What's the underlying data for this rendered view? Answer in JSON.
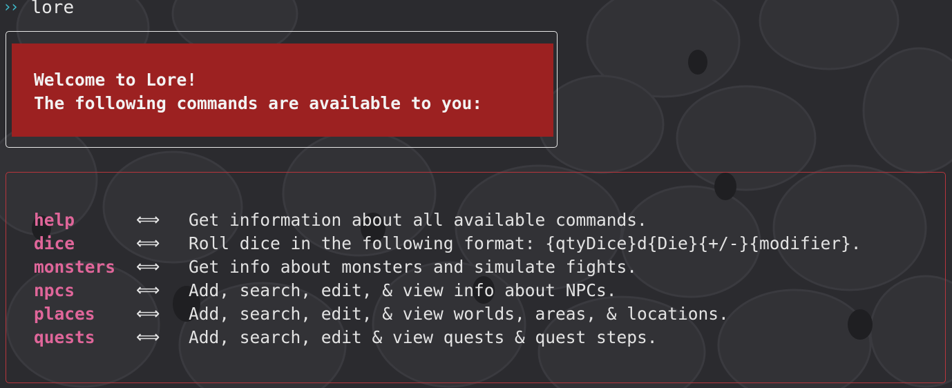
{
  "prompt": {
    "arrow": "››",
    "command": "lore"
  },
  "welcome": {
    "line1": "Welcome to Lore!",
    "line2": "The following commands are available to you:"
  },
  "commands": [
    {
      "name": "help",
      "arrow": "⟺",
      "description": "Get information about all available commands."
    },
    {
      "name": "dice",
      "arrow": "⟺",
      "description": "Roll dice in the following format: {qtyDice}d{Die}{+/-}{modifier}."
    },
    {
      "name": "monsters",
      "arrow": "⟺",
      "description": "Get info about monsters and simulate fights."
    },
    {
      "name": "npcs",
      "arrow": "⟺",
      "description": "Add, search, edit, & view info about NPCs."
    },
    {
      "name": "places",
      "arrow": "⟺",
      "description": "Add, search, edit, & view worlds, areas, & locations."
    },
    {
      "name": "quests",
      "arrow": "⟺",
      "description": "Add, search, edit & view quests & quest steps."
    }
  ],
  "colors": {
    "background": "#2a2a2e",
    "prompt_arrow": "#3fb8c9",
    "welcome_bg": "#9c2121",
    "command_name": "#e0669a",
    "command_border": "#b8363d"
  }
}
